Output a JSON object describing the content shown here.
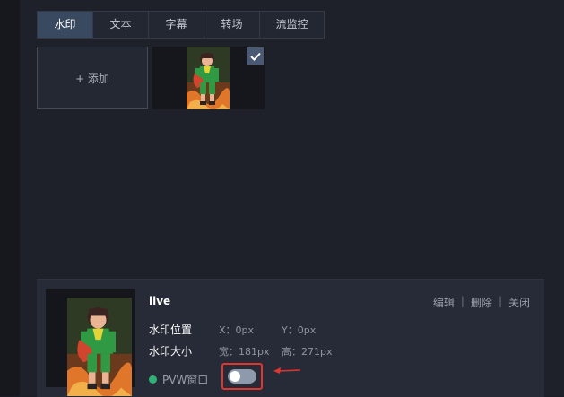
{
  "tabs": [
    {
      "label": "水印",
      "active": true
    },
    {
      "label": "文本",
      "active": false
    },
    {
      "label": "字幕",
      "active": false
    },
    {
      "label": "转场",
      "active": false
    },
    {
      "label": "流监控",
      "active": false
    }
  ],
  "add_label": "+ 添加",
  "icons": {
    "check": "checkmark-icon",
    "status": "green-status-dot",
    "annotation": "red-arrow-icon"
  },
  "colors": {
    "accent_tab": "#39495f",
    "status_green": "#2fb176",
    "highlight_red": "#e3342f"
  },
  "card": {
    "name": "live",
    "actions": {
      "edit": "编辑",
      "delete": "删除",
      "close": "关闭",
      "separator": "|"
    },
    "position": {
      "label": "水印位置",
      "x": "X：0px",
      "y": "Y：0px"
    },
    "size": {
      "label": "水印大小",
      "width": "宽：181px",
      "height": "高：271px"
    },
    "pvw_label": "PVW窗口",
    "pvw_toggle_on": false
  }
}
